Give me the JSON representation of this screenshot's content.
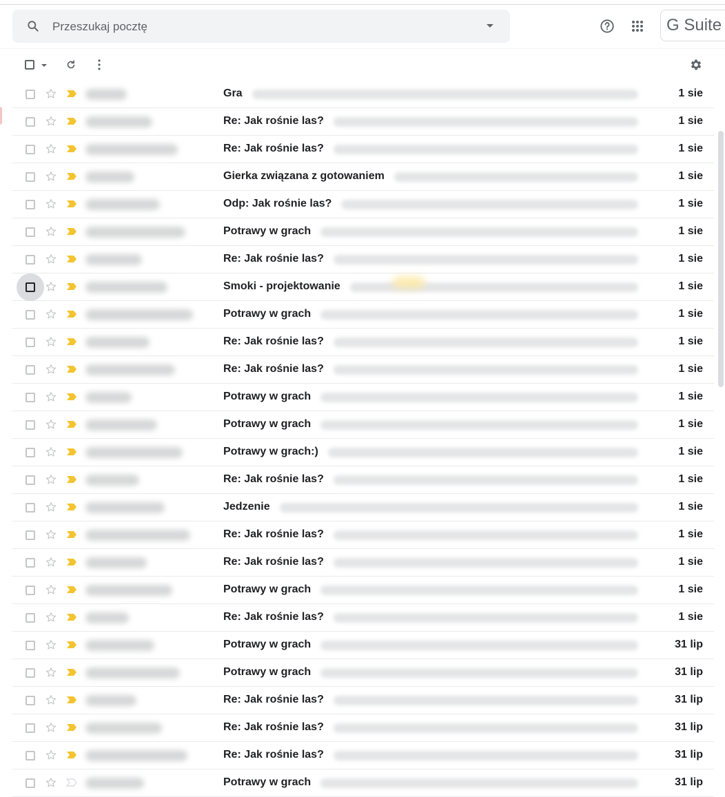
{
  "search": {
    "placeholder": "Przeszukaj pocztę"
  },
  "header": {
    "gsuite_label": "G Suite"
  },
  "icons": {
    "search": "search-icon",
    "search_options": "chevron-down-icon",
    "help": "help-circle-icon",
    "apps": "apps-grid-icon",
    "select": "checkbox-icon",
    "refresh": "refresh-icon",
    "more": "more-vertical-icon",
    "settings": "gear-icon",
    "star": "star-outline-icon",
    "important": "important-marker-icon"
  },
  "colors": {
    "important": "#f4c430",
    "important_off": "#dadce0",
    "text": "#202124",
    "icon": "#5f6368"
  },
  "emails": [
    {
      "subject": "Gra",
      "date": "1 sie",
      "important": true
    },
    {
      "subject": "Re: Jak rośnie las?",
      "date": "1 sie",
      "important": true
    },
    {
      "subject": "Re: Jak rośnie las?",
      "date": "1 sie",
      "important": true
    },
    {
      "subject": "Gierka związana z gotowaniem",
      "date": "1 sie",
      "important": true
    },
    {
      "subject": "Odp: Jak rośnie las?",
      "date": "1 sie",
      "important": true
    },
    {
      "subject": "Potrawy w grach",
      "date": "1 sie",
      "important": true
    },
    {
      "subject": "Re: Jak rośnie las?",
      "date": "1 sie",
      "important": true
    },
    {
      "subject": "Smoki - projektowanie",
      "date": "1 sie",
      "important": true,
      "hovered": true
    },
    {
      "subject": "Potrawy w grach",
      "date": "1 sie",
      "important": true
    },
    {
      "subject": "Re: Jak rośnie las?",
      "date": "1 sie",
      "important": true
    },
    {
      "subject": "Re: Jak rośnie las?",
      "date": "1 sie",
      "important": true
    },
    {
      "subject": "Potrawy w grach",
      "date": "1 sie",
      "important": true
    },
    {
      "subject": "Potrawy w grach",
      "date": "1 sie",
      "important": true
    },
    {
      "subject": "Potrawy w grach:)",
      "date": "1 sie",
      "important": true
    },
    {
      "subject": "Re: Jak rośnie las?",
      "date": "1 sie",
      "important": true
    },
    {
      "subject": "Jedzenie",
      "date": "1 sie",
      "important": true
    },
    {
      "subject": "Re: Jak rośnie las?",
      "date": "1 sie",
      "important": true
    },
    {
      "subject": "Re: Jak rośnie las?",
      "date": "1 sie",
      "important": true
    },
    {
      "subject": "Potrawy w grach",
      "date": "1 sie",
      "important": true
    },
    {
      "subject": "Re: Jak rośnie las?",
      "date": "1 sie",
      "important": true
    },
    {
      "subject": "Potrawy w grach",
      "date": "31 lip",
      "important": true
    },
    {
      "subject": "Potrawy w grach",
      "date": "31 lip",
      "important": true
    },
    {
      "subject": "Re: Jak rośnie las?",
      "date": "31 lip",
      "important": true
    },
    {
      "subject": "Re: Jak rośnie las?",
      "date": "31 lip",
      "important": true
    },
    {
      "subject": "Re: Jak rośnie las?",
      "date": "31 lip",
      "important": true
    },
    {
      "subject": "Potrawy w grach",
      "date": "31 lip",
      "important": false
    }
  ]
}
